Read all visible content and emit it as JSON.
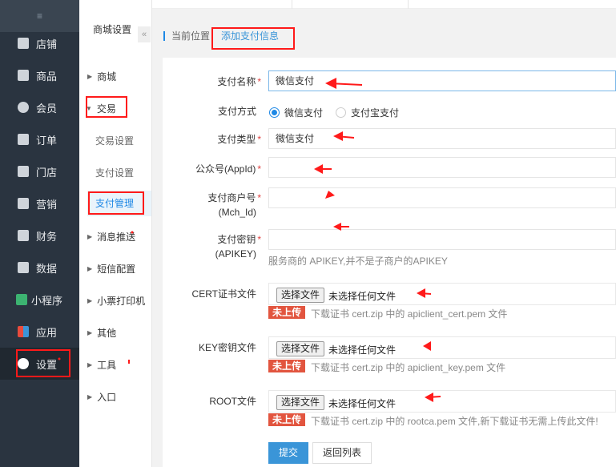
{
  "sidebar": {
    "collapse_glyph": "≡",
    "items": [
      {
        "label": "店铺",
        "icon": "store-icon"
      },
      {
        "label": "商品",
        "icon": "goods-icon"
      },
      {
        "label": "会员",
        "icon": "user-icon"
      },
      {
        "label": "订单",
        "icon": "order-icon"
      },
      {
        "label": "门店",
        "icon": "shop-icon"
      },
      {
        "label": "营销",
        "icon": "gift-icon"
      },
      {
        "label": "财务",
        "icon": "finance-icon"
      },
      {
        "label": "数据",
        "icon": "chart-icon"
      },
      {
        "label": "小程序",
        "icon": "miniprogram-icon"
      },
      {
        "label": "应用",
        "icon": "apps-icon"
      },
      {
        "label": "设置",
        "icon": "gear-icon"
      }
    ]
  },
  "subnav": {
    "title": "商城设置",
    "collapse_glyph": "«",
    "groups": [
      "商城",
      "交易",
      "消息推送",
      "短信配置",
      "小票打印机",
      "其他",
      "工具",
      "入口"
    ],
    "children": [
      "交易设置",
      "支付设置",
      "支付管理"
    ]
  },
  "breadcrumb": {
    "prefix": "当前位置：",
    "current": "添加支付信息"
  },
  "form": {
    "pay_name": {
      "label": "支付名称",
      "value": "微信支付"
    },
    "pay_method": {
      "label": "支付方式",
      "options": [
        "微信支付",
        "支付宝支付"
      ],
      "selected": "微信支付"
    },
    "pay_type": {
      "label": "支付类型",
      "value": "微信支付"
    },
    "appid": {
      "label": "公众号(AppId)",
      "value": ""
    },
    "mchid": {
      "label1": "支付商户号",
      "label2": "(Mch_Id)",
      "value": ""
    },
    "apikey": {
      "label1": "支付密钥",
      "label2": "(APIKEY)",
      "value": "",
      "hint": "服务商的 APIKEY,并不是子商户的APIKEY"
    },
    "cert": {
      "label": "CERT证书文件",
      "button": "选择文件",
      "file_text": "未选择任何文件",
      "badge": "未上传",
      "download": "下载证书 cert.zip 中的 apiclient_cert.pem 文件"
    },
    "key": {
      "label": "KEY密钥文件",
      "button": "选择文件",
      "file_text": "未选择任何文件",
      "badge": "未上传",
      "download": "下载证书 cert.zip 中的 apiclient_key.pem 文件"
    },
    "root": {
      "label": "ROOT文件",
      "button": "选择文件",
      "file_text": "未选择任何文件",
      "badge": "未上传",
      "download": "下载证书 cert.zip 中的 rootca.pem 文件,新下载证书无需上传此文件!"
    },
    "required_mark": "*",
    "submit": "提交",
    "back": "返回列表"
  },
  "colors": {
    "accent": "#3a95d8",
    "sidebar": "#2a3440",
    "badge": "#e2553f",
    "annotation": "#ff1a1a"
  }
}
